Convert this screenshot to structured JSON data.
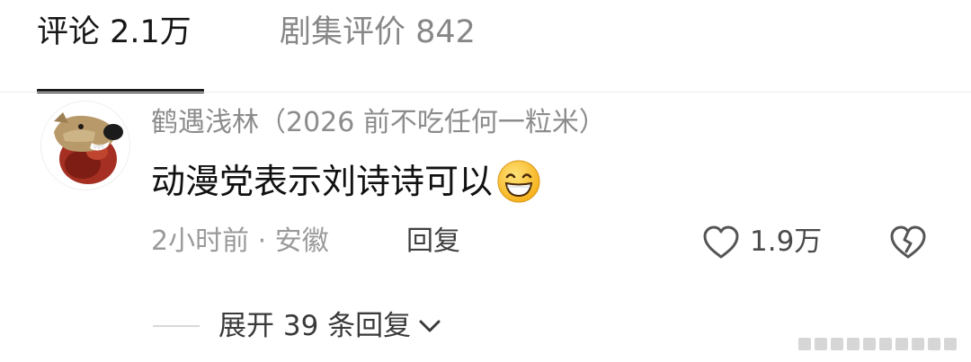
{
  "tabs": [
    {
      "label": "评论 2.1万",
      "active": true
    },
    {
      "label": "剧集评价 842",
      "active": false
    }
  ],
  "comment": {
    "username": "鹤遇浅林（2026 前不吃任何一粒米）",
    "text": "动漫党表示刘诗诗可以",
    "emoji": "grinning-sweat-emoji",
    "meta": "2小时前 · 安徽",
    "reply_label": "回复",
    "like_count": "1.9万",
    "avatar": "dog-avatar"
  },
  "replies": {
    "expand_label": "展开 39 条回复"
  },
  "icons": {
    "like": "heart-outline-icon",
    "dislike": "broken-heart-icon",
    "expand": "chevron-down-icon"
  },
  "colors": {
    "text_primary": "#111111",
    "text_secondary": "#8c8c8c",
    "active_indicator": "#1a1a1a"
  }
}
